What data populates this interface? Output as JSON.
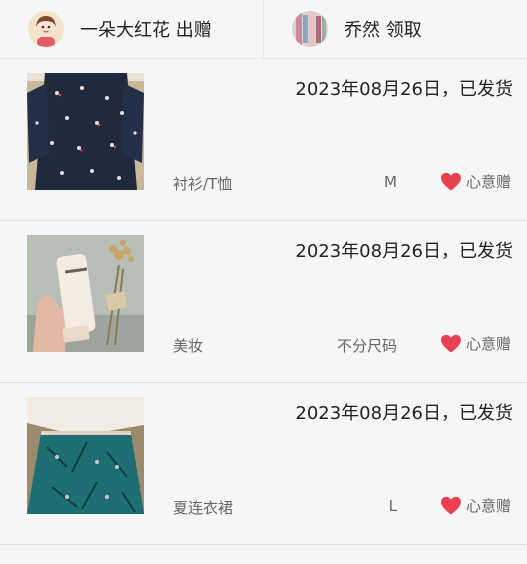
{
  "header": {
    "giver": {
      "name": "一朵大红花",
      "action": "出赠"
    },
    "receiver": {
      "name": "乔然",
      "action": "领取"
    }
  },
  "items": [
    {
      "date": "2023年08月26日，",
      "status": "已发货",
      "category": "衬衫/T恤",
      "size": "M",
      "gift_label": "心意赠",
      "image": "navy-floral-dress-photo"
    },
    {
      "date": "2023年08月26日，",
      "status": "已发货",
      "category": "美妆",
      "size": "不分尺码",
      "gift_label": "心意赠",
      "image": "cosmetic-tube-with-dried-flowers-photo"
    },
    {
      "date": "2023年08月26日，",
      "status": "已发货",
      "category": "夏连衣裙",
      "size": "L",
      "gift_label": "心意赠",
      "image": "teal-patterned-skirt-white-top-photo"
    }
  ],
  "colors": {
    "heart": "#e8404f",
    "text_dark": "#222222",
    "text_muted": "#666666",
    "background": "#f6f6f6"
  }
}
